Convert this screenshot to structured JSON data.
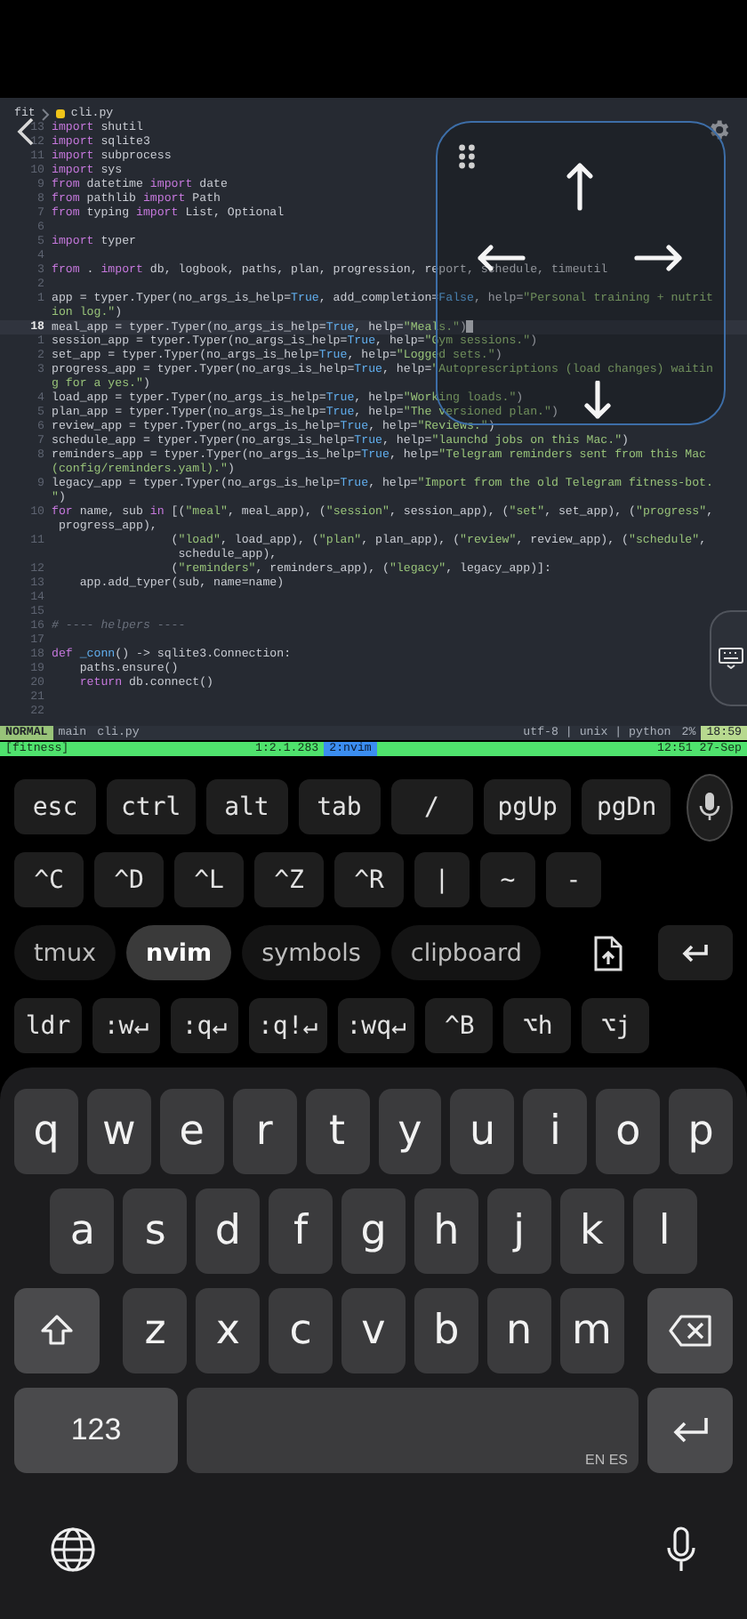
{
  "editor": {
    "breadcrumb": {
      "folder": "fit",
      "file": "cli.py"
    },
    "rows": [
      {
        "num": "13",
        "current": false,
        "segs": [
          {
            "kind": "keyword",
            "text": "import"
          },
          {
            "kind": "plain",
            "text": " shutil"
          }
        ]
      },
      {
        "num": "12",
        "current": false,
        "segs": [
          {
            "kind": "keyword",
            "text": "import"
          },
          {
            "kind": "plain",
            "text": " sqlite3"
          }
        ]
      },
      {
        "num": "11",
        "current": false,
        "segs": [
          {
            "kind": "keyword",
            "text": "import"
          },
          {
            "kind": "plain",
            "text": " subprocess"
          }
        ]
      },
      {
        "num": "10",
        "current": false,
        "segs": [
          {
            "kind": "keyword",
            "text": "import"
          },
          {
            "kind": "plain",
            "text": " sys"
          }
        ]
      },
      {
        "num": "9",
        "current": false,
        "segs": [
          {
            "kind": "keyword",
            "text": "from"
          },
          {
            "kind": "plain",
            "text": " datetime "
          },
          {
            "kind": "keyword",
            "text": "import"
          },
          {
            "kind": "plain",
            "text": " date"
          }
        ]
      },
      {
        "num": "8",
        "current": false,
        "segs": [
          {
            "kind": "keyword",
            "text": "from"
          },
          {
            "kind": "plain",
            "text": " pathlib "
          },
          {
            "kind": "keyword",
            "text": "import"
          },
          {
            "kind": "plain",
            "text": " Path"
          }
        ]
      },
      {
        "num": "7",
        "current": false,
        "segs": [
          {
            "kind": "keyword",
            "text": "from"
          },
          {
            "kind": "plain",
            "text": " typing "
          },
          {
            "kind": "keyword",
            "text": "import"
          },
          {
            "kind": "plain",
            "text": " List, Optional"
          }
        ]
      },
      {
        "num": "6",
        "current": false,
        "segs": []
      },
      {
        "num": "5",
        "current": false,
        "segs": [
          {
            "kind": "keyword",
            "text": "import"
          },
          {
            "kind": "plain",
            "text": " typer"
          }
        ]
      },
      {
        "num": "4",
        "current": false,
        "segs": []
      },
      {
        "num": "3",
        "current": false,
        "segs": [
          {
            "kind": "keyword",
            "text": "from"
          },
          {
            "kind": "plain",
            "text": " . "
          },
          {
            "kind": "keyword",
            "text": "import"
          },
          {
            "kind": "plain",
            "text": " db, logbook, paths, plan, progression, report, schedule, timeutil"
          }
        ]
      },
      {
        "num": "2",
        "current": false,
        "segs": []
      },
      {
        "num": "1",
        "current": false,
        "segs": [
          {
            "kind": "plain",
            "text": "app = typer.Typer(no_args_is_help="
          },
          {
            "kind": "constant",
            "text": "True"
          },
          {
            "kind": "plain",
            "text": ", add_completion="
          },
          {
            "kind": "constant",
            "text": "False"
          },
          {
            "kind": "plain",
            "text": ", help="
          },
          {
            "kind": "string",
            "text": "\"Personal training + nutrit"
          }
        ]
      },
      {
        "current": false,
        "segs": [
          {
            "kind": "string",
            "text": "ion log.\""
          },
          {
            "kind": "plain",
            "text": ")"
          }
        ]
      },
      {
        "num": "18",
        "current": true,
        "segs": [
          {
            "kind": "plain",
            "text": "meal_app = typer.Typer(no_args_is_help="
          },
          {
            "kind": "constant",
            "text": "True"
          },
          {
            "kind": "plain",
            "text": ", help="
          },
          {
            "kind": "string",
            "text": "\"Meals.\""
          },
          {
            "kind": "plain",
            "text": ")"
          }
        ]
      },
      {
        "num": "1",
        "current": false,
        "segs": [
          {
            "kind": "plain",
            "text": "session_app = typer.Typer(no_args_is_help="
          },
          {
            "kind": "constant",
            "text": "True"
          },
          {
            "kind": "plain",
            "text": ", help="
          },
          {
            "kind": "string",
            "text": "\"Gym sessions.\""
          },
          {
            "kind": "plain",
            "text": ")"
          }
        ]
      },
      {
        "num": "2",
        "current": false,
        "segs": [
          {
            "kind": "plain",
            "text": "set_app = typer.Typer(no_args_is_help="
          },
          {
            "kind": "constant",
            "text": "True"
          },
          {
            "kind": "plain",
            "text": ", help="
          },
          {
            "kind": "string",
            "text": "\"Logged sets.\""
          },
          {
            "kind": "plain",
            "text": ")"
          }
        ]
      },
      {
        "num": "3",
        "current": false,
        "segs": [
          {
            "kind": "plain",
            "text": "progress_app = typer.Typer(no_args_is_help="
          },
          {
            "kind": "constant",
            "text": "True"
          },
          {
            "kind": "plain",
            "text": ", help="
          },
          {
            "kind": "string",
            "text": "\"Autoprescriptions (load changes) waitin"
          }
        ]
      },
      {
        "current": false,
        "segs": [
          {
            "kind": "string",
            "text": "g for a yes.\""
          },
          {
            "kind": "plain",
            "text": ")"
          }
        ]
      },
      {
        "num": "4",
        "current": false,
        "segs": [
          {
            "kind": "plain",
            "text": "load_app = typer.Typer(no_args_is_help="
          },
          {
            "kind": "constant",
            "text": "True"
          },
          {
            "kind": "plain",
            "text": ", help="
          },
          {
            "kind": "string",
            "text": "\"Working loads.\""
          },
          {
            "kind": "plain",
            "text": ")"
          }
        ]
      },
      {
        "num": "5",
        "current": false,
        "segs": [
          {
            "kind": "plain",
            "text": "plan_app = typer.Typer(no_args_is_help="
          },
          {
            "kind": "constant",
            "text": "True"
          },
          {
            "kind": "plain",
            "text": ", help="
          },
          {
            "kind": "string",
            "text": "\"The versioned plan.\""
          },
          {
            "kind": "plain",
            "text": ")"
          }
        ]
      },
      {
        "num": "6",
        "current": false,
        "segs": [
          {
            "kind": "plain",
            "text": "review_app = typer.Typer(no_args_is_help="
          },
          {
            "kind": "constant",
            "text": "True"
          },
          {
            "kind": "plain",
            "text": ", help="
          },
          {
            "kind": "string",
            "text": "\"Reviews.\""
          },
          {
            "kind": "plain",
            "text": ")"
          }
        ]
      },
      {
        "num": "7",
        "current": false,
        "segs": [
          {
            "kind": "plain",
            "text": "schedule_app = typer.Typer(no_args_is_help="
          },
          {
            "kind": "constant",
            "text": "True"
          },
          {
            "kind": "plain",
            "text": ", help="
          },
          {
            "kind": "string",
            "text": "\"launchd jobs on this Mac.\""
          },
          {
            "kind": "plain",
            "text": ")"
          }
        ]
      },
      {
        "num": "8",
        "current": false,
        "segs": [
          {
            "kind": "plain",
            "text": "reminders_app = typer.Typer(no_args_is_help="
          },
          {
            "kind": "constant",
            "text": "True"
          },
          {
            "kind": "plain",
            "text": ", help="
          },
          {
            "kind": "string",
            "text": "\"Telegram reminders sent from this Mac"
          }
        ]
      },
      {
        "current": false,
        "segs": [
          {
            "kind": "string",
            "text": "(config/reminders.yaml).\""
          },
          {
            "kind": "plain",
            "text": ")"
          }
        ]
      },
      {
        "num": "9",
        "current": false,
        "segs": [
          {
            "kind": "plain",
            "text": "legacy_app = typer.Typer(no_args_is_help="
          },
          {
            "kind": "constant",
            "text": "True"
          },
          {
            "kind": "plain",
            "text": ", help="
          },
          {
            "kind": "string",
            "text": "\"Import from the old Telegram fitness-bot."
          }
        ]
      },
      {
        "current": false,
        "segs": [
          {
            "kind": "string",
            "text": "\""
          },
          {
            "kind": "plain",
            "text": ")"
          }
        ]
      },
      {
        "num": "10",
        "current": false,
        "segs": [
          {
            "kind": "keyword",
            "text": "for"
          },
          {
            "kind": "plain",
            "text": " name, sub "
          },
          {
            "kind": "keyword",
            "text": "in"
          },
          {
            "kind": "plain",
            "text": " [("
          },
          {
            "kind": "string",
            "text": "\"meal\""
          },
          {
            "kind": "plain",
            "text": ", meal_app), ("
          },
          {
            "kind": "string",
            "text": "\"session\""
          },
          {
            "kind": "plain",
            "text": ", session_app), ("
          },
          {
            "kind": "string",
            "text": "\"set\""
          },
          {
            "kind": "plain",
            "text": ", set_app), ("
          },
          {
            "kind": "string",
            "text": "\"progress\""
          },
          {
            "kind": "plain",
            "text": ","
          }
        ]
      },
      {
        "current": false,
        "segs": [
          {
            "kind": "plain",
            "text": " progress_app),"
          }
        ]
      },
      {
        "num": "11",
        "current": false,
        "segs": [
          {
            "kind": "plain",
            "text": "                 ("
          },
          {
            "kind": "string",
            "text": "\"load\""
          },
          {
            "kind": "plain",
            "text": ", load_app), ("
          },
          {
            "kind": "string",
            "text": "\"plan\""
          },
          {
            "kind": "plain",
            "text": ", plan_app), ("
          },
          {
            "kind": "string",
            "text": "\"review\""
          },
          {
            "kind": "plain",
            "text": ", review_app), ("
          },
          {
            "kind": "string",
            "text": "\"schedule\""
          },
          {
            "kind": "plain",
            "text": ","
          }
        ]
      },
      {
        "current": false,
        "segs": [
          {
            "kind": "plain",
            "text": "                  schedule_app),"
          }
        ]
      },
      {
        "num": "12",
        "current": false,
        "segs": [
          {
            "kind": "plain",
            "text": "                 ("
          },
          {
            "kind": "string",
            "text": "\"reminders\""
          },
          {
            "kind": "plain",
            "text": ", reminders_app), ("
          },
          {
            "kind": "string",
            "text": "\"legacy\""
          },
          {
            "kind": "plain",
            "text": ", legacy_app)]:"
          }
        ]
      },
      {
        "num": "13",
        "current": false,
        "segs": [
          {
            "kind": "plain",
            "text": "    app.add_typer(sub, name=name)"
          }
        ]
      },
      {
        "num": "14",
        "current": false,
        "segs": []
      },
      {
        "num": "15",
        "current": false,
        "segs": []
      },
      {
        "num": "16",
        "current": false,
        "segs": [
          {
            "kind": "comment",
            "text": "# ---- helpers ----"
          }
        ]
      },
      {
        "num": "17",
        "current": false,
        "segs": []
      },
      {
        "num": "18",
        "current": false,
        "segs": [
          {
            "kind": "keyword",
            "text": "def"
          },
          {
            "kind": "constant",
            "text": " _conn"
          },
          {
            "kind": "plain",
            "text": "() -> sqlite3.Connection:"
          }
        ]
      },
      {
        "num": "19",
        "current": false,
        "segs": [
          {
            "kind": "plain",
            "text": "    paths.ensure()"
          }
        ]
      },
      {
        "num": "20",
        "current": false,
        "segs": [
          {
            "kind": "keyword",
            "text": "    return"
          },
          {
            "kind": "plain",
            "text": " db.connect()"
          }
        ]
      },
      {
        "num": "21",
        "current": false,
        "segs": []
      },
      {
        "num": "22",
        "current": false,
        "segs": []
      }
    ]
  },
  "nvim_status": {
    "mode": "NORMAL",
    "branch": "main",
    "file": "cli.py",
    "file_info": "utf-8 | unix | python",
    "percent": "2%",
    "position": "18:59"
  },
  "tmux_status": {
    "session": "[fitness]",
    "pane_info": "1:2.1.283",
    "windows": [
      {
        "label": "2:nvim",
        "selected": true
      }
    ],
    "clock": "12:51 27-Sep"
  },
  "toolbar": {
    "key_row_1": [
      "esc",
      "ctrl",
      "alt",
      "tab",
      "/",
      "pgUp",
      "pgDn"
    ],
    "key_row_2": [
      "^C",
      "^D",
      "^L",
      "^Z",
      "^R",
      "|",
      "~",
      "-"
    ],
    "tabs": [
      {
        "label": "tmux",
        "selected": false
      },
      {
        "label": "nvim",
        "selected": true
      },
      {
        "label": "symbols",
        "selected": false
      },
      {
        "label": "clipboard",
        "selected": false
      }
    ],
    "key_row_4": [
      "ldr",
      ":w↵",
      ":q↵",
      ":q!↵",
      ":wq↵",
      "^B",
      "⌥h",
      "⌥j"
    ]
  },
  "keyboard": {
    "rows": [
      [
        "q",
        "w",
        "e",
        "r",
        "t",
        "y",
        "u",
        "i",
        "o",
        "p"
      ],
      [
        "a",
        "s",
        "d",
        "f",
        "g",
        "h",
        "j",
        "k",
        "l"
      ],
      [
        "z",
        "x",
        "c",
        "v",
        "b",
        "n",
        "m"
      ]
    ],
    "number_key": "123",
    "languages": "EN ES"
  }
}
